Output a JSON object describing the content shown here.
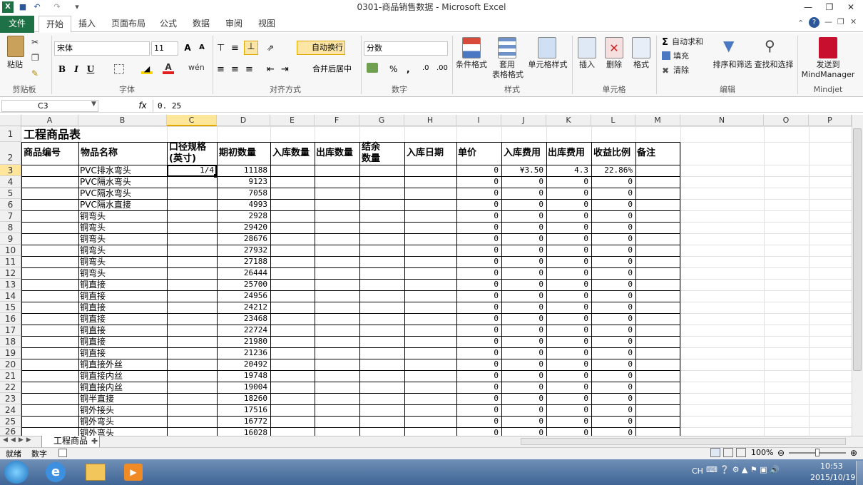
{
  "window": {
    "title": "0301-商品销售数据 - Microsoft Excel",
    "quick_access": [
      "save-icon",
      "undo-icon",
      "redo-icon",
      "customize-icon"
    ],
    "controls": [
      "minimize",
      "restore",
      "close"
    ]
  },
  "tabs": [
    "文件",
    "开始",
    "插入",
    "页面布局",
    "公式",
    "数据",
    "审阅",
    "视图"
  ],
  "active_tab": "开始",
  "ribbon": {
    "clipboard": {
      "paste": "粘贴",
      "label": "剪贴板"
    },
    "font": {
      "name": "宋体",
      "size": "11",
      "bold": "B",
      "italic": "I",
      "underline": "U",
      "label": "字体"
    },
    "alignment": {
      "wrap": "自动换行",
      "merge": "合并后居中",
      "label": "对齐方式"
    },
    "number": {
      "format": "分数",
      "percent": "%",
      "comma": ",",
      "label": "数字"
    },
    "styles": {
      "conditional": "条件格式",
      "table_format_1": "套用",
      "table_format_2": "表格格式",
      "cell_styles": "单元格样式",
      "label": "样式"
    },
    "cells": {
      "insert": "插入",
      "delete": "删除",
      "format": "格式",
      "label": "单元格"
    },
    "editing": {
      "autosum": "自动求和",
      "fill": "填充",
      "clear": "清除",
      "sort": "排序和筛选",
      "find": "查找和选择",
      "label": "编辑"
    },
    "mindjet": {
      "send_1": "发送到",
      "send_2": "MindManager",
      "label": "Mindjet"
    }
  },
  "formula_bar": {
    "name_box": "C3",
    "fx": "fx",
    "value": "0. 25"
  },
  "columns": [
    "A",
    "B",
    "C",
    "D",
    "E",
    "F",
    "G",
    "H",
    "I",
    "J",
    "K",
    "L",
    "M",
    "N",
    "O",
    "P"
  ],
  "sheet": {
    "title": "工程商品表",
    "headers": {
      "A": "商品编号",
      "B": "物品名称",
      "C1": "口径规格",
      "C2": "(英寸)",
      "D": "期初数量",
      "E": "入库数量",
      "F": "出库数量",
      "G1": "结余",
      "G2": "数量",
      "H": "入库日期",
      "I": "单价",
      "J": "入库费用",
      "K": "出库费用",
      "L": "收益比例",
      "M": "备注"
    },
    "row_numbers": [
      "1",
      "2",
      "3",
      "4",
      "5",
      "6",
      "7",
      "8",
      "9",
      "10",
      "11",
      "12",
      "13",
      "14",
      "15",
      "16",
      "17",
      "18",
      "19",
      "20",
      "21",
      "22",
      "23",
      "24",
      "25",
      "26"
    ],
    "rows": [
      {
        "B": "PVC排水弯头",
        "C": "1/4",
        "D": "11188",
        "I": "0",
        "J": "¥3.50",
        "K": "4.3",
        "L": "22.86%"
      },
      {
        "B": "PVC隔水弯头",
        "C": "",
        "D": "9123",
        "I": "0",
        "J": "0",
        "K": "0",
        "L": "0"
      },
      {
        "B": "PVC隔水弯头",
        "C": "",
        "D": "7058",
        "I": "0",
        "J": "0",
        "K": "0",
        "L": "0"
      },
      {
        "B": "PVC隔水直接",
        "C": "",
        "D": "4993",
        "I": "0",
        "J": "0",
        "K": "0",
        "L": "0"
      },
      {
        "B": "铜弯头",
        "C": "",
        "D": "2928",
        "I": "0",
        "J": "0",
        "K": "0",
        "L": "0"
      },
      {
        "B": "铜弯头",
        "C": "",
        "D": "29420",
        "I": "0",
        "J": "0",
        "K": "0",
        "L": "0"
      },
      {
        "B": "铜弯头",
        "C": "",
        "D": "28676",
        "I": "0",
        "J": "0",
        "K": "0",
        "L": "0"
      },
      {
        "B": "铜弯头",
        "C": "",
        "D": "27932",
        "I": "0",
        "J": "0",
        "K": "0",
        "L": "0"
      },
      {
        "B": "铜弯头",
        "C": "",
        "D": "27188",
        "I": "0",
        "J": "0",
        "K": "0",
        "L": "0"
      },
      {
        "B": "铜弯头",
        "C": "",
        "D": "26444",
        "I": "0",
        "J": "0",
        "K": "0",
        "L": "0"
      },
      {
        "B": "铜直接",
        "C": "",
        "D": "25700",
        "I": "0",
        "J": "0",
        "K": "0",
        "L": "0"
      },
      {
        "B": "铜直接",
        "C": "",
        "D": "24956",
        "I": "0",
        "J": "0",
        "K": "0",
        "L": "0"
      },
      {
        "B": "铜直接",
        "C": "",
        "D": "24212",
        "I": "0",
        "J": "0",
        "K": "0",
        "L": "0"
      },
      {
        "B": "铜直接",
        "C": "",
        "D": "23468",
        "I": "0",
        "J": "0",
        "K": "0",
        "L": "0"
      },
      {
        "B": "铜直接",
        "C": "",
        "D": "22724",
        "I": "0",
        "J": "0",
        "K": "0",
        "L": "0"
      },
      {
        "B": "铜直接",
        "C": "",
        "D": "21980",
        "I": "0",
        "J": "0",
        "K": "0",
        "L": "0"
      },
      {
        "B": "铜直接",
        "C": "",
        "D": "21236",
        "I": "0",
        "J": "0",
        "K": "0",
        "L": "0"
      },
      {
        "B": "铜直接外丝",
        "C": "",
        "D": "20492",
        "I": "0",
        "J": "0",
        "K": "0",
        "L": "0"
      },
      {
        "B": "铜直接内丝",
        "C": "",
        "D": "19748",
        "I": "0",
        "J": "0",
        "K": "0",
        "L": "0"
      },
      {
        "B": "铜直接内丝",
        "C": "",
        "D": "19004",
        "I": "0",
        "J": "0",
        "K": "0",
        "L": "0"
      },
      {
        "B": "铜半直接",
        "C": "",
        "D": "18260",
        "I": "0",
        "J": "0",
        "K": "0",
        "L": "0"
      },
      {
        "B": "铜外接头",
        "C": "",
        "D": "17516",
        "I": "0",
        "J": "0",
        "K": "0",
        "L": "0"
      },
      {
        "B": "铜外弯头",
        "C": "",
        "D": "16772",
        "I": "0",
        "J": "0",
        "K": "0",
        "L": "0"
      },
      {
        "B": "铜外弯头",
        "C": "",
        "D": "16028",
        "I": "0",
        "J": "0",
        "K": "0",
        "L": "0"
      }
    ]
  },
  "sheet_tab": "工程商品",
  "status": {
    "ready": "就绪",
    "mode": "数字",
    "zoom": "100%"
  },
  "taskbar": {
    "lang": "CH",
    "time": "10:53",
    "date": "2015/10/19"
  },
  "colors": {
    "excel_green": "#1e7145",
    "accent": "#2b579a"
  }
}
